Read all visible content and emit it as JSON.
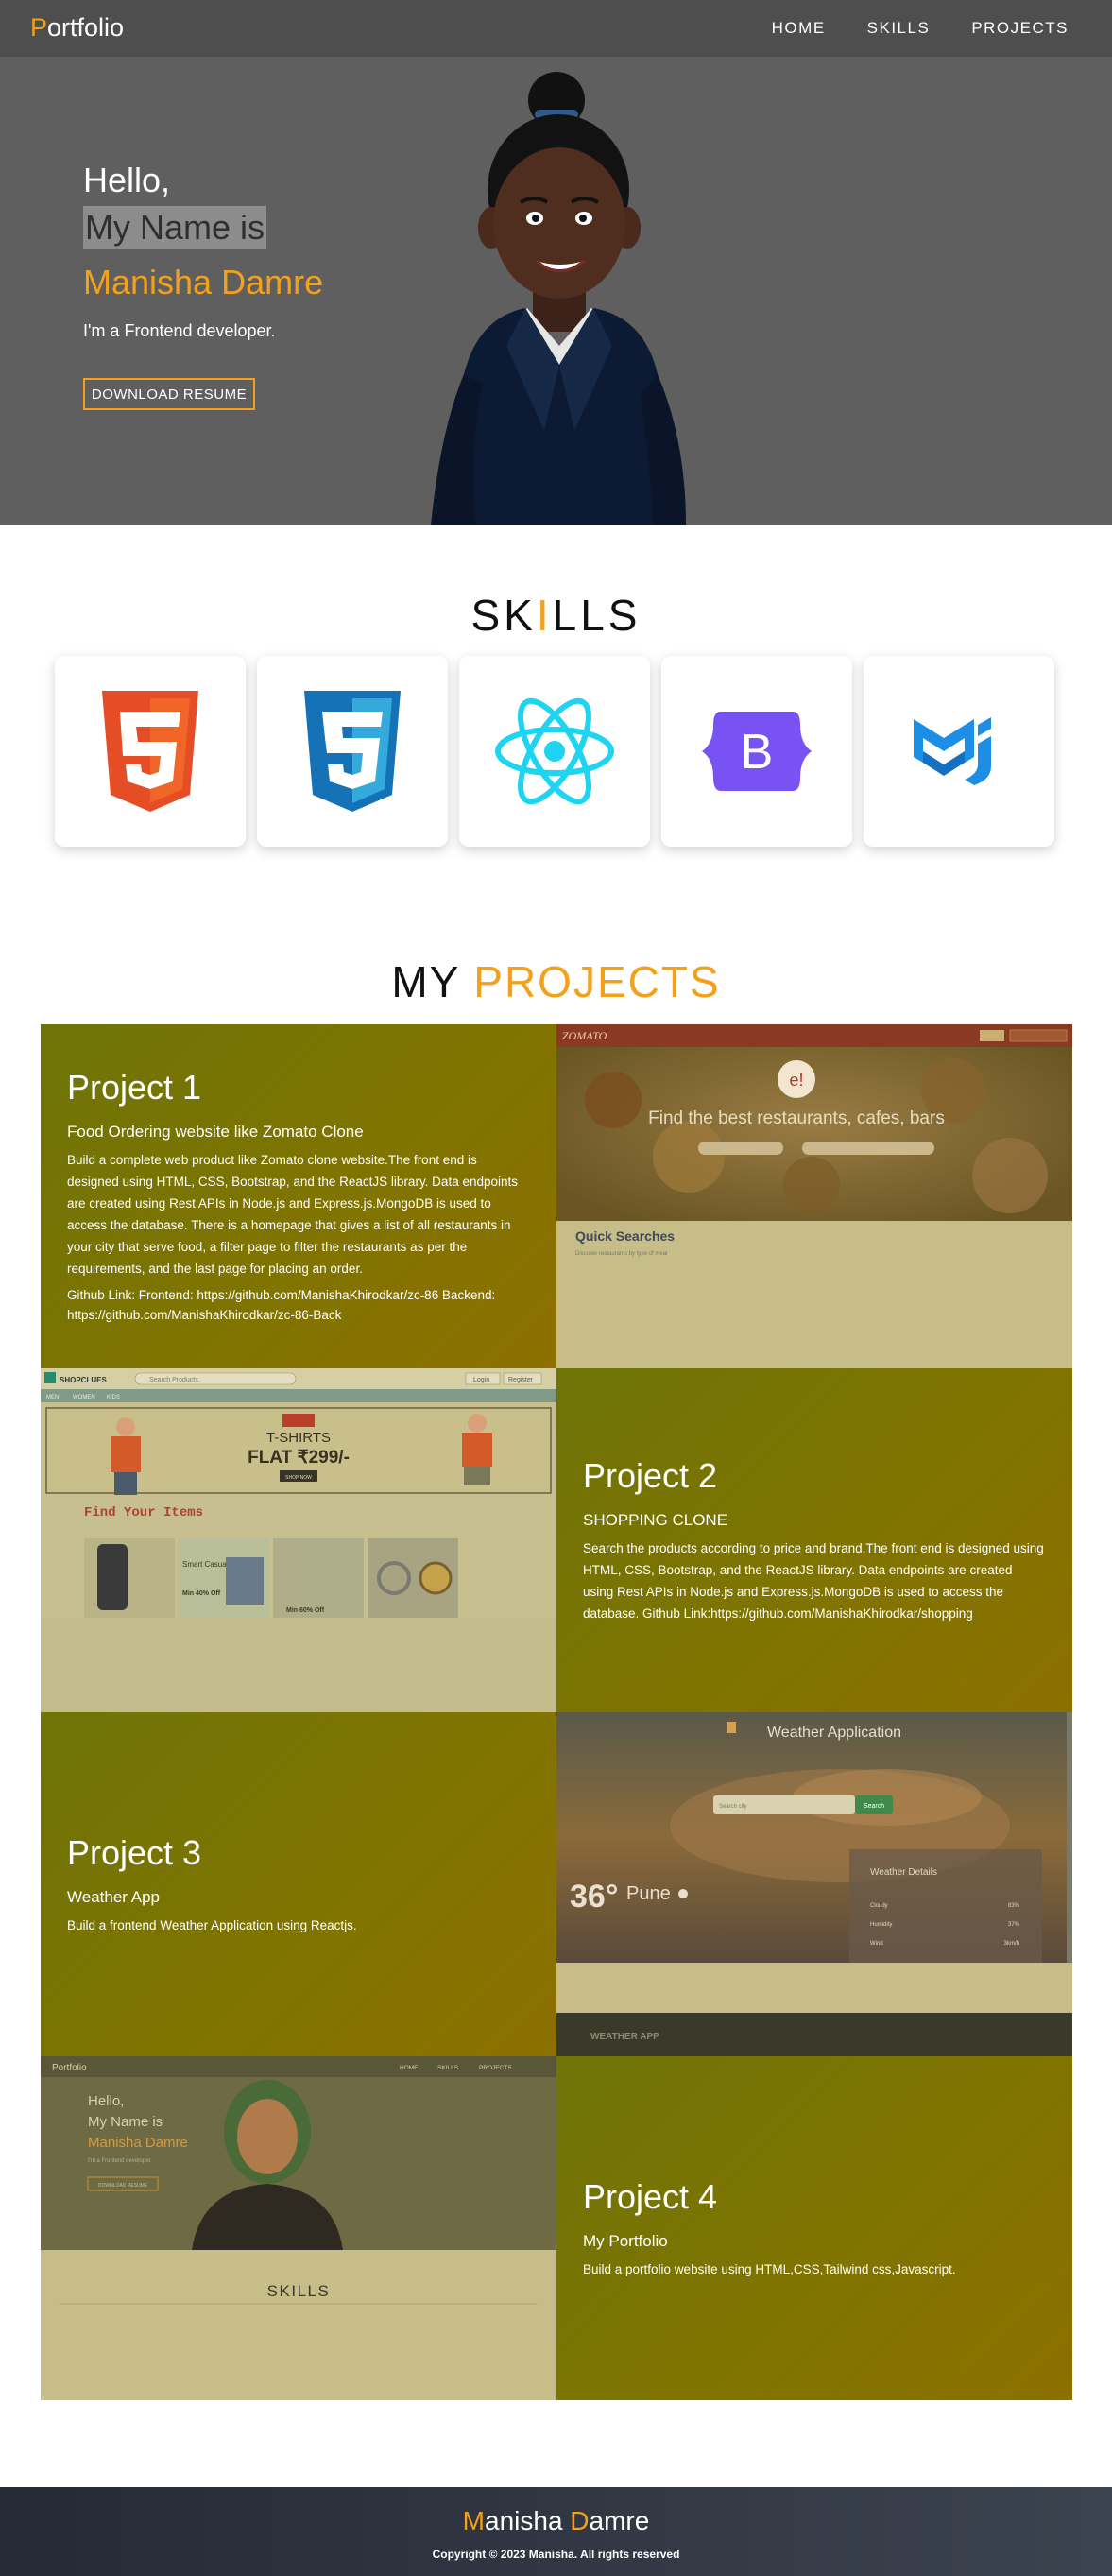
{
  "nav": {
    "brand_first": "P",
    "brand_rest": "ortfolio",
    "items": [
      "HOME",
      "SKILLS",
      "PROJECTS"
    ]
  },
  "hero": {
    "hello": "Hello,",
    "name_intro": "My Name is",
    "name": "Manisha Damre",
    "role": "I'm a Frontend developer.",
    "button": "DOWNLOAD RESUME"
  },
  "skills": {
    "title_a": "SK",
    "title_i": "I",
    "title_b": "LLS",
    "items": [
      "html5-icon",
      "css3-icon",
      "react-icon",
      "bootstrap-icon",
      "material-ui-icon"
    ]
  },
  "projects": {
    "title_a": "MY",
    "title_b": "PROJECTS",
    "list": [
      {
        "heading": "Project 1",
        "subtitle": "Food Ordering website like Zomato Clone",
        "description": "Build a complete web product like Zomato clone website.The front end is designed using HTML, CSS, Bootstrap, and the ReactJS library. Data endpoints are created using Rest APIs in Node.js and Express.js.MongoDB is used to access the database. There is a homepage that gives a list of all restaurants in your city that serve food, a filter page to filter the restaurants as per the requirements, and the last page for placing an order.",
        "links": "Github Link: Frontend: https://github.com/ManishaKhirodkar/zc-86 Backend: https://github.com/ManishaKhirodkar/zc-86-Back"
      },
      {
        "heading": "Project 2",
        "subtitle": "SHOPPING CLONE",
        "description": "Search the products according to price and brand.The front end is designed using HTML, CSS, Bootstrap, and the ReactJS library. Data endpoints are created using Rest APIs in Node.js and Express.js.MongoDB is used to access the database. Github Link:https://github.com/ManishaKhirodkar/shopping"
      },
      {
        "heading": "Project 3",
        "subtitle": "Weather App",
        "description": "Build a frontend Weather Application using Reactjs."
      },
      {
        "heading": "Project 4",
        "subtitle": "My Portfolio",
        "description": "Build a portfolio website using HTML,CSS,Tailwind css,Javascript."
      }
    ],
    "screenshots": {
      "zomato": {
        "logo": "ZOMATO",
        "login": "Login",
        "create": "Create an account",
        "badge": "e!",
        "tagline": "Find the best restaurants, cafes, bars",
        "quick": "Quick Searches",
        "quick_sub": "Discover restaurants by type of meal"
      },
      "shopping": {
        "logo": "SHOPCLUES",
        "search": "Search Products",
        "login": "Login",
        "register": "Register",
        "nav": [
          "MEN",
          "WOMEN",
          "KIDS"
        ],
        "banner_title": "T-SHIRTS",
        "banner_price": "FLAT ₹299/-",
        "banner_btn": "SHOP NOW",
        "find": "Find Your Items",
        "card1": "Smart Casual Shirts",
        "card1_off": "Min 40% Off",
        "card2_off": "Min 60% Off"
      },
      "weather": {
        "title": "Weather Application",
        "search": "Search city",
        "search_btn": "Search",
        "temp": "36°",
        "city": "Pune",
        "details": "Weather Details",
        "rows": [
          {
            "label": "Cloudy",
            "value": "83%"
          },
          {
            "label": "Humidity",
            "value": "37%"
          },
          {
            "label": "Wind",
            "value": "3km/h"
          }
        ],
        "footer": "WEATHER APP"
      },
      "portfolio": {
        "brand": "Portfolio",
        "nav": [
          "HOME",
          "SKILLS",
          "PROJECTS"
        ],
        "hello": "Hello,",
        "name_intro": "My Name is",
        "name": "Manisha Damre",
        "role": "I'm a Frontend developer.",
        "button": "DOWNLOAD RESUME",
        "skills": "SKILLS"
      }
    }
  },
  "footer": {
    "name_m1": "M",
    "name_r1": "anisha ",
    "name_m2": "D",
    "name_r2": "amre",
    "copyright": "Copyright © 2023 Manisha. All rights reserved"
  },
  "colors": {
    "accent": "#f3a11b",
    "nav_bg": "#4e4e4e",
    "hero_bg": "#5f5f5f",
    "project_bg": "#807400"
  }
}
